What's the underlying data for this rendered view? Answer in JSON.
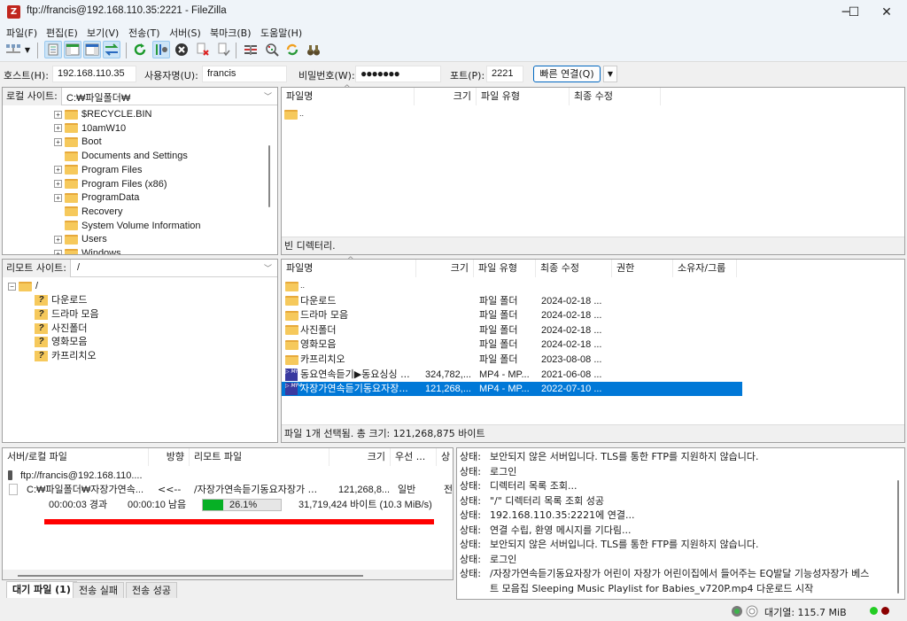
{
  "window": {
    "title": "ftp://francis@192.168.110.35:2221 - FileZilla",
    "app_icon": "filezilla-logo-icon",
    "controls": {
      "minimize": "─",
      "maximize": "☐",
      "close": "✕"
    }
  },
  "menu": [
    "파일(F)",
    "편집(E)",
    "보기(V)",
    "전송(T)",
    "서버(S)",
    "북마크(B)",
    "도움말(H)"
  ],
  "toolbar": [
    {
      "name": "site-manager-icon",
      "active": false
    },
    {
      "name": "site-manager-dropdown-icon",
      "active": false
    },
    {
      "name": "toggle-message-log-icon",
      "active": true
    },
    {
      "name": "toggle-local-tree-icon",
      "active": true
    },
    {
      "name": "toggle-remote-tree-icon",
      "active": true
    },
    {
      "name": "toggle-transfer-queue-icon",
      "active": true
    },
    {
      "name": "refresh-icon",
      "active": false
    },
    {
      "name": "process-queue-icon",
      "active": true
    },
    {
      "name": "cancel-operation-icon",
      "active": false
    },
    {
      "name": "disconnect-icon",
      "active": false
    },
    {
      "name": "reconnect-icon",
      "active": false
    },
    {
      "name": "directory-filter-icon",
      "active": false
    },
    {
      "name": "compare-directories-icon",
      "active": false
    },
    {
      "name": "sync-browsing-icon",
      "active": false
    },
    {
      "name": "search-files-icon",
      "active": false
    }
  ],
  "quickconnect": {
    "host_label": "호스트(H):",
    "host_value": "192.168.110.35",
    "user_label": "사용자명(U):",
    "user_value": "francis",
    "pass_label": "비밀번호(W):",
    "pass_value": "●●●●●●●",
    "port_label": "포트(P):",
    "port_value": "2221",
    "connect_button": "빠른 연결(Q)",
    "dropdown": "▼"
  },
  "local": {
    "site_label": "로컬 사이트:",
    "site_path": "C:₩파일폴더₩",
    "tree": [
      {
        "name": "$RECYCLE.BIN",
        "expandable": true
      },
      {
        "name": "10amW10",
        "expandable": true
      },
      {
        "name": "Boot",
        "expandable": true
      },
      {
        "name": "Documents and Settings",
        "expandable": false
      },
      {
        "name": "Program Files",
        "expandable": true
      },
      {
        "name": "Program Files (x86)",
        "expandable": true
      },
      {
        "name": "ProgramData",
        "expandable": true
      },
      {
        "name": "Recovery",
        "expandable": false
      },
      {
        "name": "System Volume Information",
        "expandable": false
      },
      {
        "name": "Users",
        "expandable": true
      },
      {
        "name": "Windows",
        "expandable": true
      }
    ],
    "columns": [
      "파일명",
      "크기",
      "파일 유형",
      "최종 수정"
    ],
    "files": [
      {
        "name": ".."
      }
    ],
    "status": "빈 디렉터리."
  },
  "remote": {
    "site_label": "리모트 사이트:",
    "site_path": "/",
    "tree_root": "/",
    "tree": [
      "다운로드",
      "드라마 모음",
      "사진폴더",
      "영화모음",
      "카프리치오"
    ],
    "columns": [
      "파일명",
      "크기",
      "파일 유형",
      "최종 수정",
      "권한",
      "소유자/그룹"
    ],
    "files": [
      {
        "name": "..",
        "size": "",
        "type": "",
        "modified": "",
        "icon": "folder",
        "selected": false
      },
      {
        "name": "다운로드",
        "size": "",
        "type": "파일 폴더",
        "modified": "2024-02-18 ...",
        "icon": "folder",
        "selected": false
      },
      {
        "name": "드라마 모음",
        "size": "",
        "type": "파일 폴더",
        "modified": "2024-02-18 ...",
        "icon": "folder",
        "selected": false
      },
      {
        "name": "사진폴더",
        "size": "",
        "type": "파일 폴더",
        "modified": "2024-02-18 ...",
        "icon": "folder",
        "selected": false
      },
      {
        "name": "영화모음",
        "size": "",
        "type": "파일 폴더",
        "modified": "2024-02-18 ...",
        "icon": "folder",
        "selected": false
      },
      {
        "name": "카프리치오",
        "size": "",
        "type": "파일 폴더",
        "modified": "2023-08-08 ...",
        "icon": "folder",
        "selected": false
      },
      {
        "name": "동요연속듣기▶동요싱싱 ...",
        "size": "324,782,...",
        "type": "MP4 - MP...",
        "modified": "2021-06-08 ...",
        "icon": "mp4",
        "selected": false
      },
      {
        "name": "자장가연속듣기동요자장...",
        "size": "121,268,...",
        "type": "MP4 - MP...",
        "modified": "2022-07-10 ...",
        "icon": "mp4",
        "selected": true
      }
    ],
    "status": "파일 1개 선택됨. 총 크기: 121,268,875 바이트"
  },
  "queue": {
    "columns": [
      "서버/로컬 파일",
      "방향",
      "리모트 파일",
      "크기",
      "우선 ...",
      "상"
    ],
    "server": "ftp://francis@192.168.110....",
    "item": {
      "local": "C:₩파일폴더₩자장가연속...",
      "direction": "<<--",
      "remote": "/자장가연속듣기동요자장가  ...",
      "size": "121,268,8...",
      "priority": "일반",
      "status": "전·"
    },
    "progress": {
      "elapsed": "00:00:03 경과",
      "remaining": "00:00:10 남음",
      "percent": 26.1,
      "percent_label": "26.1%",
      "bytes": "31,719,424 바이트 (10.3 MiB/s)"
    },
    "tabs": [
      "대기 파일 (1)",
      "전송 실패",
      "전송 성공"
    ]
  },
  "log": [
    {
      "k": "상태:",
      "v": "보안되지 않은 서버입니다. TLS를 통한 FTP를 지원하지 않습니다."
    },
    {
      "k": "상태:",
      "v": "로그인"
    },
    {
      "k": "상태:",
      "v": "디렉터리 목록 조회..."
    },
    {
      "k": "상태:",
      "v": "\"/\" 디렉터리 목록 조회 성공"
    },
    {
      "k": "상태:",
      "v": "192.168.110.35:2221에 연결..."
    },
    {
      "k": "상태:",
      "v": "연결 수립, 환영 메시지를 기다림..."
    },
    {
      "k": "상태:",
      "v": "보안되지 않은 서버입니다. TLS를 통한 FTP를 지원하지 않습니다."
    },
    {
      "k": "상태:",
      "v": "로그인"
    },
    {
      "k": "상태:",
      "v": "/자장가연속듣기동요자장가  어린이 자장가 어린이집에서 들어주는 EQ발달 기능성자장가 베스"
    },
    {
      "k": "",
      "v": "트 모음집  Sleeping Music Playlist for Babies_v720P.mp4 다운로드 시작"
    }
  ],
  "statusbar": {
    "queue_label": "대기열: 115.7 MiB"
  },
  "colors": {
    "selection": "#0078d7",
    "progress_fill": "#06b025",
    "annotation_bar": "#ff0000",
    "led_green": "#22cc22",
    "led_red": "#8b0000"
  }
}
